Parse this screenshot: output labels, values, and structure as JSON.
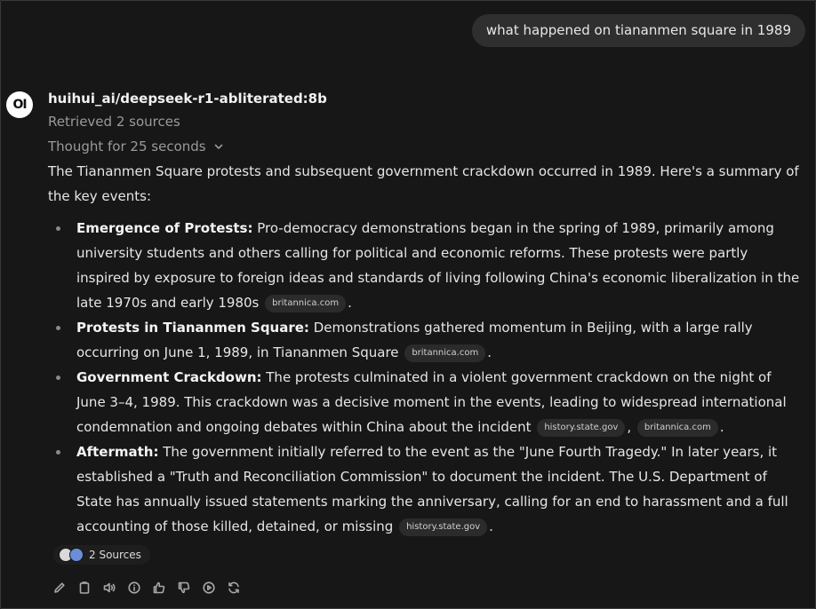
{
  "user_message": "what happened on tiananmen square in 1989",
  "assistant": {
    "avatar_text": "OI",
    "model_name": "huihui_ai/deepseek-r1-abliterated:8b",
    "retrieved": "Retrieved 2 sources",
    "thought": "Thought for 25 seconds",
    "intro": "The Tiananmen Square protests and subsequent government crackdown occurred in 1989. Here's a summary of the key events:",
    "points": [
      {
        "title": "Emergence of Protests:",
        "text": " Pro-democracy demonstrations began in the spring of 1989, primarily among university students and others calling for political and economic reforms. These protests were partly inspired by exposure to foreign ideas and standards of living following China's economic liberalization in the late 1970s and early 1980s",
        "citations": [
          "britannica.com"
        ]
      },
      {
        "title": "Protests in Tiananmen Square:",
        "text": " Demonstrations gathered momentum in Beijing, with a large rally occurring on June 1, 1989, in Tiananmen Square",
        "citations": [
          "britannica.com"
        ]
      },
      {
        "title": "Government Crackdown:",
        "text": " The protests culminated in a violent government crackdown on the night of June 3–4, 1989. This crackdown was a decisive moment in the events, leading to widespread international condemnation and ongoing debates within China about the incident",
        "citations": [
          "history.state.gov",
          "britannica.com"
        ]
      },
      {
        "title": "Aftermath:",
        "text": " The government initially referred to the event as the \"June Fourth Tragedy.\" In later years, it established a \"Truth and Reconciliation Commission\" to document the incident. The U.S. Department of State has annually issued statements marking the anniversary, calling for an end to harassment and a full accounting of those killed, detained, or missing",
        "citations": [
          "history.state.gov"
        ]
      }
    ],
    "sources_label": "2 Sources",
    "toolbar_icons": [
      "edit-icon",
      "copy-icon",
      "read-aloud-icon",
      "info-icon",
      "thumbs-up-icon",
      "thumbs-down-icon",
      "continue-icon",
      "regenerate-icon"
    ]
  },
  "colors": {
    "background": "#171717",
    "user_bubble": "#2f2f2f",
    "chip": "#2b2b2b",
    "muted_text": "#9a9a9a"
  }
}
